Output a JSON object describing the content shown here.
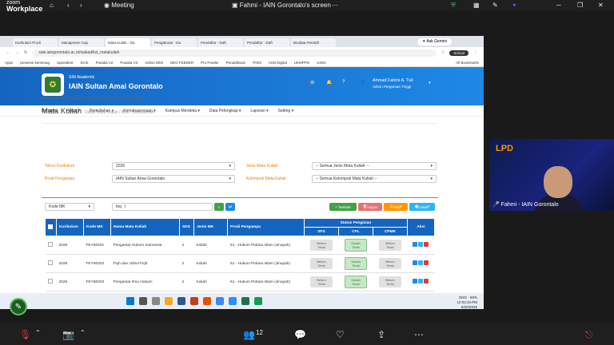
{
  "zoom": {
    "brand_top": "zoom",
    "brand": "Workplace",
    "meeting_label": "Meeting",
    "screen_title": "Fahmi - IAIN Gorontalo's screen",
    "participant_count": "12",
    "participant_name": "Fahmi - IAIN Gorontalo"
  },
  "browser": {
    "tabs": [
      "Kurikulum Prodi",
      "Manajemen Cap",
      "Mata Kuliah - Da",
      "Pengaturan - Da",
      "Pendaftar - Daft",
      "Pendaftar - Daft",
      "Biodata Pendaft"
    ],
    "gemini_label": "Ask Gemini",
    "url": "siak.iaingorontalo.ac.id/siakad/list_matakuliah",
    "school_label": "School",
    "bookmarks": [
      "Apps",
      "presensi kemenag",
      "Speedtest",
      "SIAK",
      "Pusaka V2",
      "Pusaka V3",
      "Admin Dikti",
      "NEO FEEDER",
      "Pro Feeder",
      "Pendaftaran",
      "PISN",
      "ASN Digital",
      "UKMPPG",
      "UIGN",
      "All Bookmarks"
    ]
  },
  "header": {
    "system_name": "SIM Akademik",
    "institution": "IAIN Sultan Amai Gorontalo",
    "lang": "ID",
    "user_name": "Ahmad Fahmi A. Tuli",
    "user_role": "Admin Perguruan Tinggi"
  },
  "nav": [
    "Beranda",
    "Portal",
    "Perkuliahan",
    "Kemahasiswaan",
    "Kampus Merdeka",
    "Data Pelengkap",
    "Laporan",
    "Setting"
  ],
  "breadcrumb": [
    "Beranda",
    "Perkuliahan",
    "Manajemen Kurikulum",
    "Mata Kuliah"
  ],
  "page": {
    "title": "Mata Kuliah",
    "subtitle": "Daftar Mata Kuliah / Blok / Departemen"
  },
  "filters": {
    "tahun_label": "Tahun Kurikulum",
    "tahun_value": "2026",
    "prodi_label": "Prodi Pengampu",
    "prodi_value": "IAIN Sultan Amai Gorontalo",
    "jenis_label": "Jenis Mata Kuliah",
    "jenis_value": "-- Semua Jenis Mata Kuliah --",
    "kelompok_label": "Kelompok Mata Kuliah",
    "kelompok_value": "-- Semua Kelompok Mata Kuliah --"
  },
  "search": {
    "field_select": "Kode MK",
    "query": "feq"
  },
  "buttons": {
    "tambah": "+ Tambah",
    "hapus": "Hapus",
    "aksi": "Aksi",
    "cetak": "Cetak"
  },
  "table": {
    "headers": [
      "Kurikulum",
      "Kode MK",
      "Nama Mata Kuliah",
      "SKS",
      "Jenis MK",
      "Prodi Pengampu",
      "Status Pengisian",
      "SPS",
      "CPL",
      "CPMK",
      "Aksi"
    ],
    "rows": [
      {
        "kurikulum": "2026",
        "kode": "FEY60201",
        "nama": "Pengantar Hukum Indonesia",
        "sks": "2",
        "jenis": "Kuliah",
        "prodi": "S1 - Hukum Pidana Islam (Jinayah)",
        "sps": "Belum Terisi",
        "cpl": "Sudah Terisi",
        "cpmk": "Belum Terisi"
      },
      {
        "kurikulum": "2026",
        "kode": "FEY60202",
        "nama": "Fiqh dan Ushul Fiqh",
        "sks": "2",
        "jenis": "Kuliah",
        "prodi": "S1 - Hukum Pidana Islam (Jinayah)",
        "sps": "Belum Terisi",
        "cpl": "Sudah Terisi",
        "cpmk": "Belum Terisi"
      },
      {
        "kurikulum": "2026",
        "kode": "FEY60203",
        "nama": "Pengantar Ilmu Hukum",
        "sks": "2",
        "jenis": "Kuliah",
        "prodi": "S1 - Hukum Pidana Islam (Jinayah)",
        "sps": "Belum Terisi",
        "cpl": "Sudah Terisi",
        "cpmk": "Belum Terisi"
      }
    ]
  },
  "taskbar": {
    "time": "12:02:34 PM",
    "date": "8/20/2026",
    "lang": "ENG",
    "battery": "60%"
  },
  "colors": {
    "primary": "#1565c0",
    "success": "#43a047",
    "danger": "#e57373",
    "warning": "#ff9800",
    "info": "#29b6f6"
  }
}
